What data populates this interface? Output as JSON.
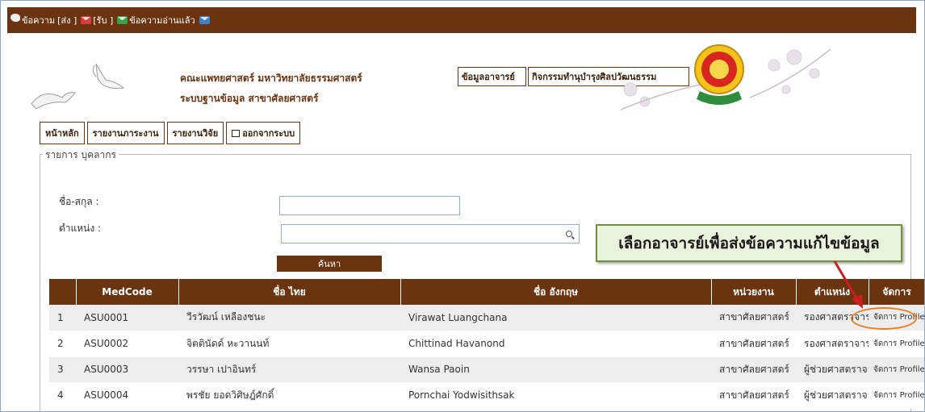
{
  "msgbar": {
    "message": "ข้อความ",
    "sent": "[ส่ง ]",
    "received": "[รับ ]",
    "read": "ข้อความอ่านแล้ว",
    "colors": {
      "bar": "#6b3410",
      "sent_icon": "#d83a3a",
      "received_icon": "#3aa04a",
      "read_icon": "#3f7fc6"
    }
  },
  "header": {
    "faculty": "คณะแพทยศาสตร์ มหาวิทยาลัยธรรมศาสตร์",
    "system": "ระบบฐานข้อมูล สาขาศัลยศาสตร์",
    "btn_teacher_info": "ข้อมูลอาจารย์",
    "btn_activities": "กิจกรรมทำนุบำรุงศิลปวัฒนธรรม"
  },
  "nav": {
    "home": "หน้าหลัก",
    "workload_report": "รายงานภาระงาน",
    "research_report": "รายงานวิจัย",
    "logout": "ออกจากระบบ"
  },
  "panel": {
    "legend": "รายการ บุคลากร",
    "name_label": "ชื่อ-สกุล :",
    "name_value": "",
    "position_label": "ตำแหน่ง :",
    "position_value": "",
    "search_button": "ค้นหา"
  },
  "callout": {
    "text": "เลือกอาจารย์เพื่อส่งข้อความแก้ไขข้อมูล",
    "colors": {
      "fill": "#e9f2dc",
      "border": "#6f8f3d",
      "highlight_ring": "#e87d20",
      "arrow": "#cc1f1f"
    }
  },
  "table": {
    "headers": [
      "",
      "MedCode",
      "ชื่อ ไทย",
      "ชื่อ อังกฤษ",
      "หน่วยงาน",
      "ตำแหน่ง",
      "จัดการ"
    ],
    "rows": [
      {
        "no": "1",
        "code": "ASU0001",
        "thai": "วีรวัฒน์ เหลืองชนะ",
        "eng": "Virawat Luangchana",
        "unit": "สาขาศัลยศาสตร์",
        "position": "รองศาสตราจารย์",
        "action": "จัดการ Profile"
      },
      {
        "no": "2",
        "code": "ASU0002",
        "thai": "จิตตินัดด์ หะวานนท์",
        "eng": "Chittinad Havanond",
        "unit": "สาขาศัลยศาสตร์",
        "position": "รองศาสตราจารย์",
        "action": "จัดการ Profile"
      },
      {
        "no": "3",
        "code": "ASU0003",
        "thai": "วรรษา เปาอินทร์",
        "eng": "Wansa Paoin",
        "unit": "สาขาศัลยศาสตร์",
        "position": "ผู้ช่วยศาสตราจารย์",
        "action": "จัดการ Profile"
      },
      {
        "no": "4",
        "code": "ASU0004",
        "thai": "พรชัย ยอดวิศิษฎ์ศักดิ์",
        "eng": "Pornchai Yodwisithsak",
        "unit": "สาขาศัลยศาสตร์",
        "position": "ผู้ช่วยศาสตราจารย์",
        "action": "จัดการ Profile"
      }
    ]
  }
}
